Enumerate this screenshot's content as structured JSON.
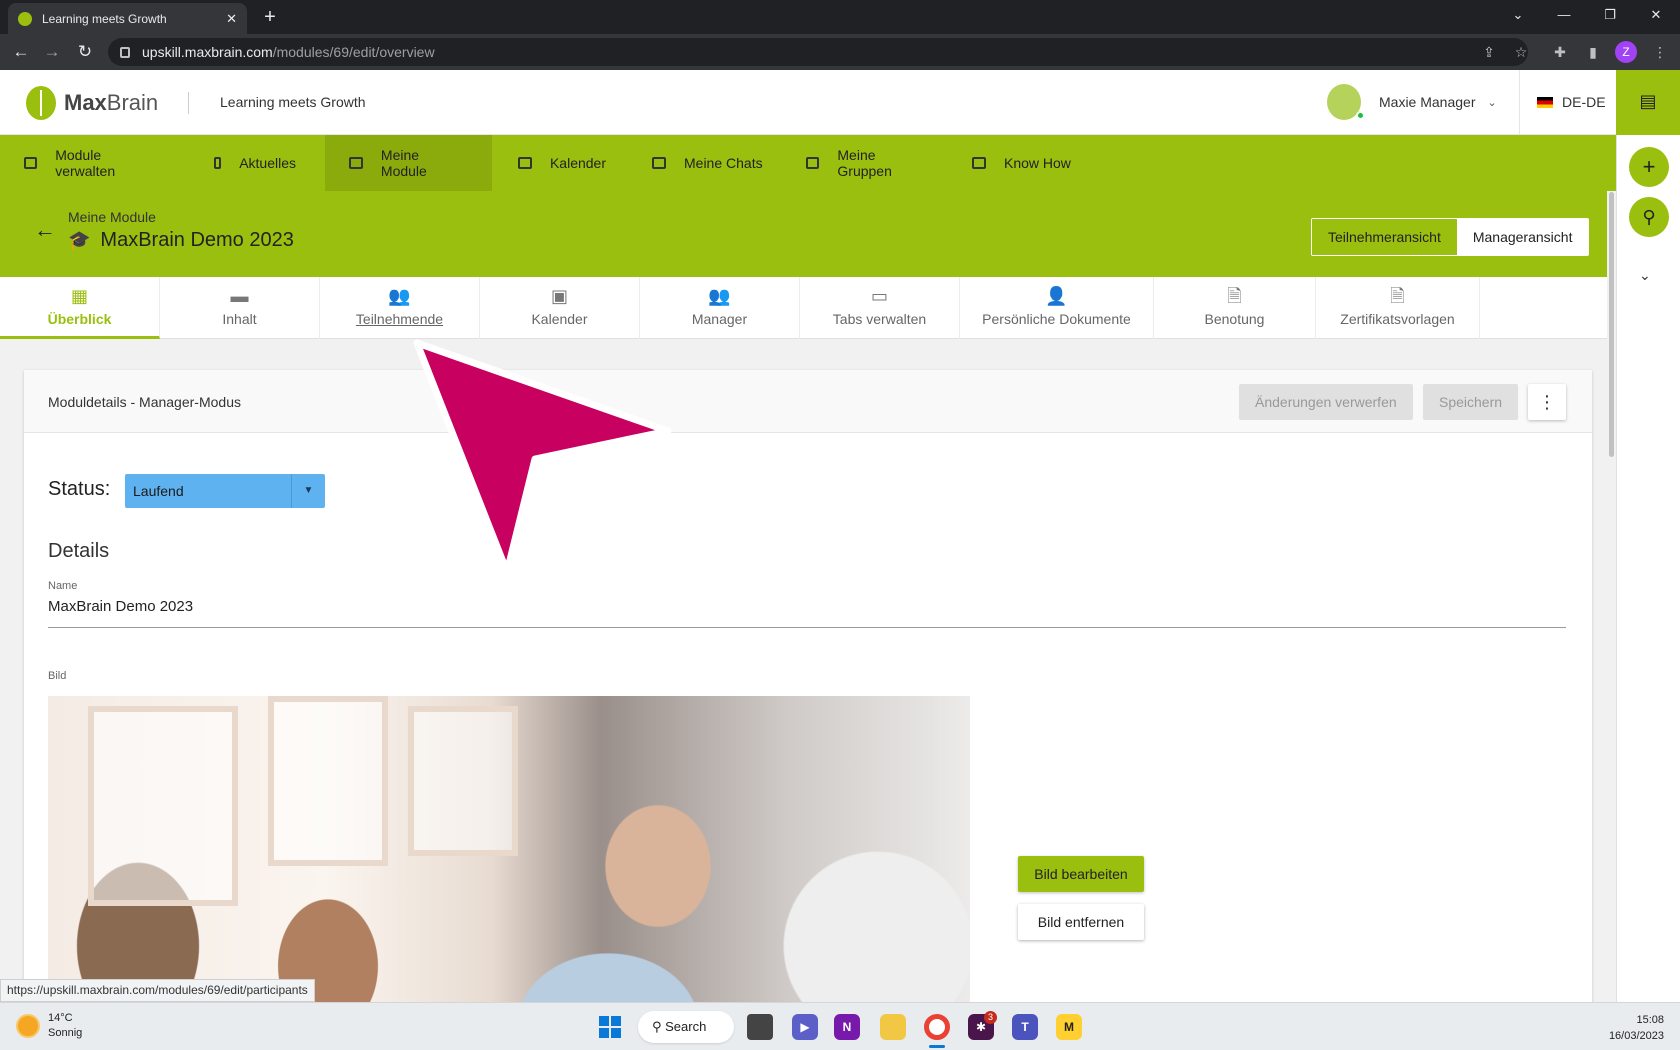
{
  "browser": {
    "tab_title": "Learning meets Growth",
    "tab_close": "✕",
    "new_tab": "+",
    "url_host": "upskill.maxbrain.com",
    "url_path": "/modules/69/edit/overview",
    "profile_initial": "Z",
    "status_url": "https://upskill.maxbrain.com/modules/69/edit/participants"
  },
  "header": {
    "brand_bold": "Max",
    "brand_light": "Brain",
    "tagline": "Learning meets Growth",
    "user_name": "Maxie Manager",
    "language": "DE-DE"
  },
  "main_nav": [
    {
      "label": "Module verwalten",
      "icon": "briefcase-icon"
    },
    {
      "label": "Aktuelles",
      "icon": "library-icon"
    },
    {
      "label": "Meine Module",
      "icon": "graduation-cap-icon",
      "active": true
    },
    {
      "label": "Kalender",
      "icon": "calendar-icon"
    },
    {
      "label": "Meine Chats",
      "icon": "inbox-icon"
    },
    {
      "label": "Meine Gruppen",
      "icon": "group-folder-icon"
    },
    {
      "label": "Know How",
      "icon": "book-icon"
    }
  ],
  "page": {
    "breadcrumb": "Meine Module",
    "title": "MaxBrain Demo 2023",
    "view_participant": "Teilnehmeransicht",
    "view_manager": "Manageransicht"
  },
  "sub_tabs": [
    {
      "label": "Überblick",
      "icon": "dashboard-icon",
      "glyph": "▦",
      "active": true
    },
    {
      "label": "Inhalt",
      "icon": "folder-icon",
      "glyph": "▬"
    },
    {
      "label": "Teilnehmende",
      "icon": "people-icon",
      "glyph": "👥",
      "hover": true
    },
    {
      "label": "Kalender",
      "icon": "calendar-icon",
      "glyph": "▣"
    },
    {
      "label": "Manager",
      "icon": "people-icon",
      "glyph": "👥"
    },
    {
      "label": "Tabs verwalten",
      "icon": "window-icon",
      "glyph": "▭"
    },
    {
      "label": "Persönliche Dokumente",
      "icon": "person-doc-icon",
      "glyph": "👤"
    },
    {
      "label": "Benotung",
      "icon": "grade-doc-icon",
      "glyph": "🗎"
    },
    {
      "label": "Zertifikatsvorlagen",
      "icon": "cert-settings-icon",
      "glyph": "🗎"
    }
  ],
  "card": {
    "title": "Moduldetails - Manager-Modus",
    "discard_label": "Änderungen verwerfen",
    "save_label": "Speichern",
    "status_label": "Status:",
    "status_value": "Laufend",
    "details_heading": "Details",
    "name_label": "Name",
    "name_value": "MaxBrain Demo 2023",
    "image_label": "Bild",
    "edit_image": "Bild bearbeiten",
    "remove_image": "Bild entfernen"
  },
  "taskbar": {
    "temperature": "14°C",
    "weather": "Sonnig",
    "search": "Search",
    "slack_badge": "3",
    "time": "15:08",
    "date": "16/03/2023"
  },
  "colors": {
    "brand_green": "#9bbf0f",
    "active_nav": "#8aab0b",
    "status_select": "#5fb2f0",
    "pointer": "#c8005f"
  }
}
